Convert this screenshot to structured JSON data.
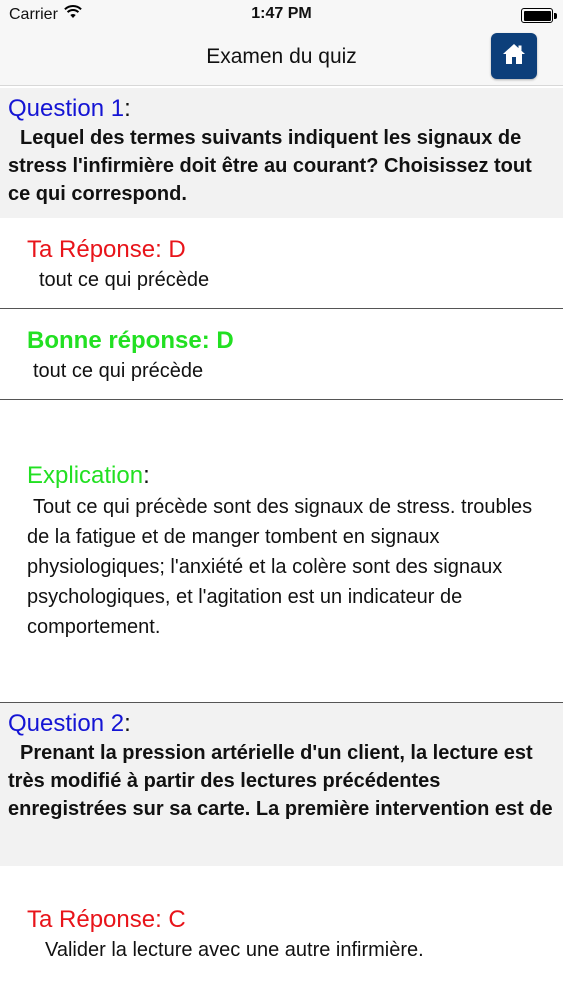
{
  "status_bar": {
    "carrier": "Carrier",
    "time": "1:47 PM"
  },
  "nav": {
    "title": "Examen du quiz"
  },
  "colors": {
    "question_label": "#1414d4",
    "your_answer": "#e8141a",
    "correct_answer": "#22e022",
    "home_button": "#0d3f7a"
  },
  "questions": [
    {
      "label": "Question 1",
      "colon": ":",
      "text": "Lequel des termes suivants indiquent les signaux de stress l'infirmière doit être au courant? Choisissez tout ce qui correspond.",
      "your_answer": {
        "label": "Ta Réponse: D",
        "text": "tout ce qui précède"
      },
      "correct_answer": {
        "label": "Bonne réponse: D",
        "text": "tout ce qui précède"
      },
      "explanation": {
        "label": "Explication",
        "colon": ":",
        "text": "Tout ce qui précède sont des signaux de stress. troubles de la fatigue et de manger tombent en signaux physiologiques; l'anxiété et la colère sont des signaux psychologiques, et l'agitation est un indicateur de comportement."
      }
    },
    {
      "label": "Question 2",
      "colon": ":",
      "text": "Prenant la pression artérielle d'un client, la lecture est très modifié à partir des lectures précédentes enregistrées sur sa carte. La première intervention est de",
      "your_answer": {
        "label": "Ta Réponse: C",
        "text": "Valider la lecture avec une autre infirmière."
      }
    }
  ]
}
